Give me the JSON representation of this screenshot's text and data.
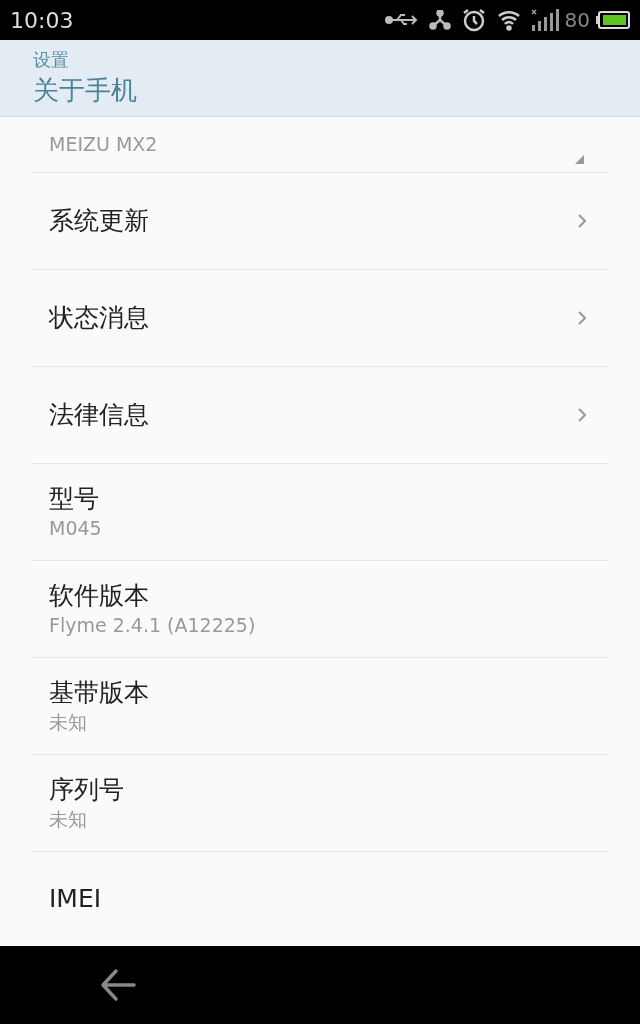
{
  "status_bar": {
    "time": "10:03",
    "battery_text": "80"
  },
  "header": {
    "parent": "设置",
    "title": "关于手机"
  },
  "top_row": {
    "value": "MEIZU MX2"
  },
  "rows": [
    {
      "kind": "link",
      "title": "系统更新"
    },
    {
      "kind": "link",
      "title": "状态消息"
    },
    {
      "kind": "link",
      "title": "法律信息"
    },
    {
      "kind": "info",
      "title": "型号",
      "value": "M045"
    },
    {
      "kind": "info",
      "title": "软件版本",
      "value": "Flyme 2.4.1 (A12225)"
    },
    {
      "kind": "info",
      "title": "基带版本",
      "value": "未知"
    },
    {
      "kind": "info",
      "title": "序列号",
      "value": "未知"
    },
    {
      "kind": "plain",
      "title": "IMEI"
    }
  ]
}
